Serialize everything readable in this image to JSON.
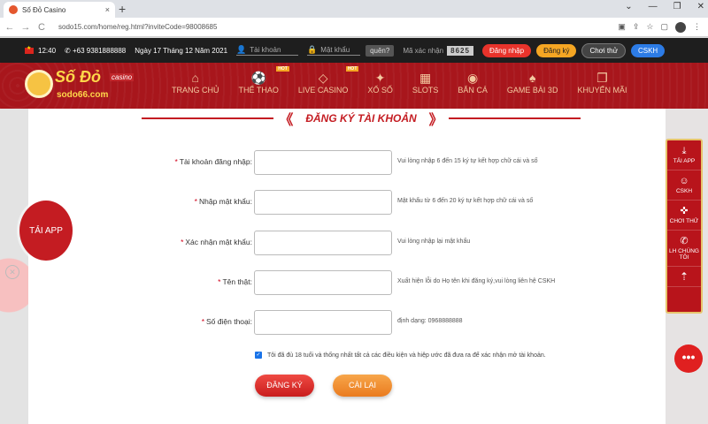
{
  "browser": {
    "tab_title": "Số Đỏ Casino",
    "tab_close": "×",
    "new_tab": "+",
    "url": "sodo15.com/home/reg.html?inviteCode=98008685",
    "nav_back": "←",
    "nav_forward": "→",
    "nav_reload": "C",
    "win_min": "—",
    "win_max": "❐",
    "win_close": "✕",
    "win_down": "⌄"
  },
  "topbar": {
    "time": "12:40",
    "phone": "+63 9381888888",
    "date": "Ngày 17 Tháng 12 Năm 2021",
    "username_placeholder": "Tài khoản",
    "password_placeholder": "Mật khẩu",
    "forgot": "quên?",
    "captcha_label": "Mã xác nhận",
    "captcha_code": "8625",
    "login": "Đăng nhập",
    "register": "Đăng ký",
    "demo": "Chơi thử",
    "cskh": "CSKH"
  },
  "logo": {
    "name": "Số Đỏ",
    "suffix": "casino",
    "domain": "sodo66.com"
  },
  "nav": [
    {
      "label": "TRANG CHỦ",
      "icon": "home-icon",
      "hot": ""
    },
    {
      "label": "THỂ THAO",
      "icon": "sports-icon",
      "hot": "HOT"
    },
    {
      "label": "LIVE CASINO",
      "icon": "diamond-icon",
      "hot": "HOT"
    },
    {
      "label": "XỔ SỐ",
      "icon": "lottery-icon",
      "hot": ""
    },
    {
      "label": "SLOTS",
      "icon": "slots-icon",
      "hot": ""
    },
    {
      "label": "BẮN CÁ",
      "icon": "fish-icon",
      "hot": ""
    },
    {
      "label": "GAME BÀI 3D",
      "icon": "cards-icon",
      "hot": ""
    },
    {
      "label": "KHUYẾN MÃI",
      "icon": "gift-icon",
      "hot": ""
    }
  ],
  "form": {
    "title": "ĐĂNG KÝ TÀI KHOẢN",
    "fields": [
      {
        "label": "Tài khoản đăng nhập:",
        "hint": "Vui lòng nhập 6 đến 15 ký tự kết hợp chữ cái và số"
      },
      {
        "label": "Nhập mật khẩu:",
        "hint": "Mật khẩu từ 6 đến 20 ký tự kết hợp chữ cái và số"
      },
      {
        "label": "Xác nhận mật khẩu:",
        "hint": "Vui lòng nhập lại mật khẩu"
      },
      {
        "label": "Tên thật:",
        "hint": "Xuất hiện lỗi do Họ tên khi đăng ký,vui lòng liên hệ CSKH"
      },
      {
        "label": "Số điện thoại:",
        "hint": "định dạng: 0968888888"
      }
    ],
    "agree": "Tôi đã đủ 18 tuổi và thống nhất tất cả các điều kiện và hiệp ước đã đưa ra để xác nhận mở tài khoản.",
    "register_btn": "ĐĂNG KÝ",
    "reset_btn": "CÀI LẠI"
  },
  "float": {
    "tai_app": "TẢI APP"
  },
  "sidebar": [
    {
      "label": "TẢI APP",
      "icon": "download-icon"
    },
    {
      "label": "CSKH",
      "icon": "support-icon"
    },
    {
      "label": "CHƠI THỬ",
      "icon": "gamepad-icon"
    },
    {
      "label": "LH CHÚNG TÔI",
      "icon": "phone-icon"
    }
  ],
  "colors": {
    "brand_red": "#c41c22",
    "accent_orange": "#f5a623",
    "cskh_blue": "#2c7be5"
  }
}
